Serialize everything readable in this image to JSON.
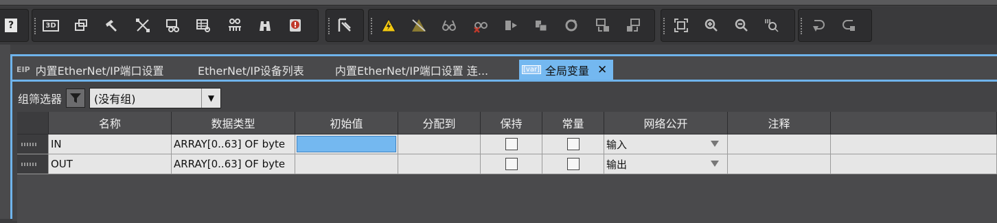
{
  "toolbar": {
    "groups": [
      {
        "name": "g0",
        "buttons": [
          "help-icon"
        ]
      },
      {
        "name": "g1",
        "buttons": [
          "3d-icon",
          "window-icon",
          "hammer-icon",
          "cross-arrows-icon",
          "reference-icon",
          "table-icon",
          "network-icon",
          "binoculars-icon",
          "error-book-icon"
        ]
      },
      {
        "name": "g2",
        "buttons": [
          "build-icon"
        ]
      },
      {
        "name": "g3",
        "buttons": [
          "warning-icon",
          "warning-off-icon",
          "glasses-icon",
          "glasses-off-icon",
          "step-icon",
          "stop-icon",
          "refresh-icon",
          "transfer-icon",
          "transfer-alt-icon"
        ]
      },
      {
        "name": "g4",
        "buttons": [
          "fit-icon",
          "zoom-in-icon",
          "zoom-out-icon",
          "zoom-100-icon"
        ]
      },
      {
        "name": "g5",
        "buttons": [
          "undo-icon",
          "redo-icon"
        ]
      }
    ],
    "help_label": "?",
    "threeD_label": "3D"
  },
  "tabs": [
    {
      "icon": "EIP",
      "label": "内置EtherNet/IP端口设置",
      "active": false
    },
    {
      "icon": "",
      "label": "EtherNet/IP设备列表",
      "active": false
    },
    {
      "icon": "",
      "label": "内置EtherNet/IP端口设置 连...",
      "active": false
    },
    {
      "icon": "[var]",
      "label": "全局变量",
      "active": true
    }
  ],
  "filter": {
    "label": "组筛选器",
    "selected": "(没有组)"
  },
  "table": {
    "columns": [
      "名称",
      "数据类型",
      "初始值",
      "分配到",
      "保持",
      "常量",
      "网络公开",
      "注释"
    ],
    "rows": [
      {
        "name": "IN",
        "type": "ARRAY[0..63] OF byte",
        "initial": "",
        "assign": "",
        "retain": false,
        "constant": false,
        "network": "输入",
        "comment": ""
      },
      {
        "name": "OUT",
        "type": "ARRAY[0..63] OF byte",
        "initial": "",
        "assign": "",
        "retain": false,
        "constant": false,
        "network": "输出",
        "comment": ""
      }
    ]
  },
  "colors": {
    "accent": "#74b8f0",
    "warning": "#f2c811"
  }
}
